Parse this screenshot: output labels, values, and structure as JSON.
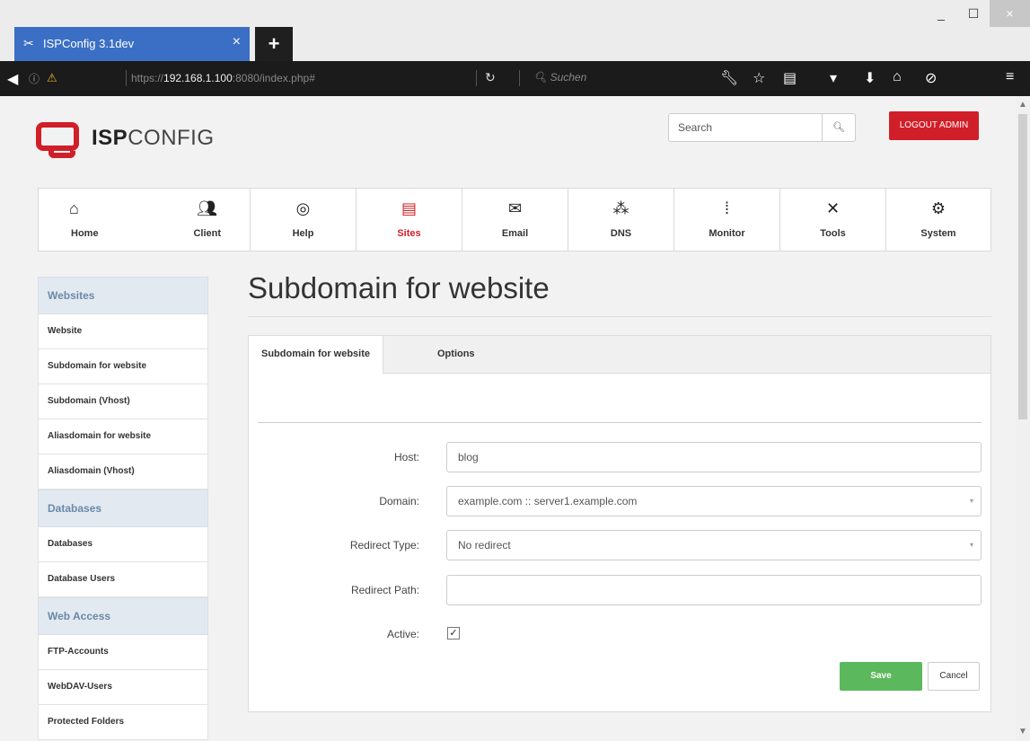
{
  "browser": {
    "tab_title": "ISPConfig 3.1dev",
    "tab_close": "×",
    "new_tab": "+",
    "url_prefix": "https://",
    "url_host": "192.168.1.100",
    "url_rest": ":8080/index.php#",
    "search_placeholder": "Suchen",
    "window_min": "_",
    "window_max": "☐",
    "window_close": "×"
  },
  "header": {
    "logo_strong": "ISP",
    "logo_rest": "CONFIG",
    "search_placeholder": "Search",
    "search_button_icon": "search-icon",
    "logout_label": "LOGOUT ADMIN"
  },
  "mainnav": {
    "items": [
      {
        "label": "Home",
        "icon": "home-icon"
      },
      {
        "label": "Client",
        "icon": "users-icon"
      },
      {
        "label": "Help",
        "icon": "lifebuoy-icon"
      },
      {
        "label": "Sites",
        "icon": "window-icon"
      },
      {
        "label": "Email",
        "icon": "envelope-icon"
      },
      {
        "label": "DNS",
        "icon": "network-icon"
      },
      {
        "label": "Monitor",
        "icon": "traffic-light-icon"
      },
      {
        "label": "Tools",
        "icon": "tools-icon"
      },
      {
        "label": "System",
        "icon": "gear-icon"
      }
    ],
    "active": "Sites",
    "active_color": "#d11f29"
  },
  "sidebar": {
    "sections": [
      {
        "title": "Websites",
        "items": [
          "Website",
          "Subdomain for website",
          "Subdomain (Vhost)",
          "Aliasdomain for website",
          "Aliasdomain (Vhost)"
        ]
      },
      {
        "title": "Databases",
        "items": [
          "Databases",
          "Database Users"
        ]
      },
      {
        "title": "Web Access",
        "items": [
          "FTP-Accounts",
          "WebDAV-Users",
          "Protected Folders"
        ]
      }
    ]
  },
  "content": {
    "title": "Subdomain for website",
    "tabs": [
      "Subdomain for website",
      "Options"
    ],
    "form": {
      "host_label": "Host:",
      "host_value": "blog",
      "domain_label": "Domain:",
      "domain_value": "example.com :: server1.example.com",
      "redirect_type_label": "Redirect Type:",
      "redirect_type_value": "No redirect",
      "redirect_path_label": "Redirect Path:",
      "redirect_path_value": "",
      "active_label": "Active:",
      "active_checked": true
    },
    "save_label": "Save",
    "cancel_label": "Cancel",
    "save_color": "#5cb85c"
  }
}
